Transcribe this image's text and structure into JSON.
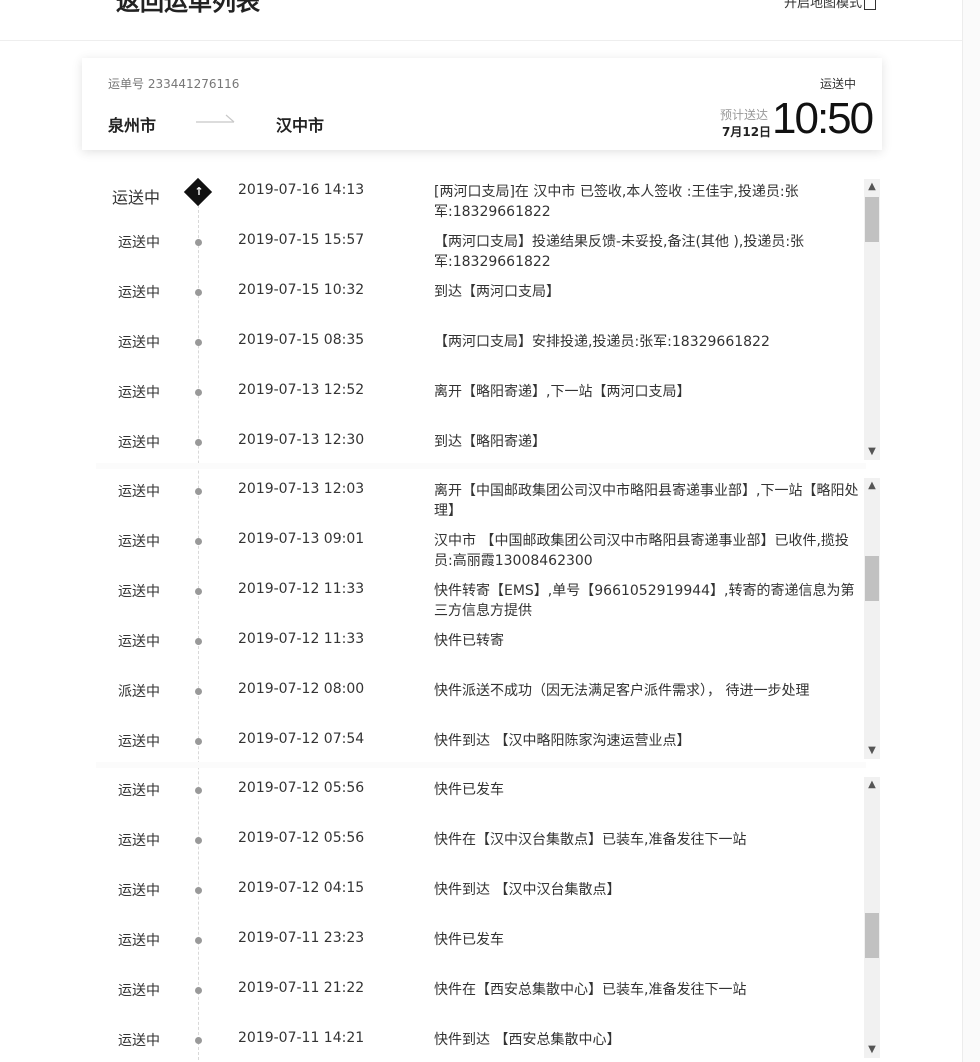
{
  "header": {
    "back_icon": "chevron-left-icon",
    "title": "返回运单列表",
    "map_mode": "开启地图模式"
  },
  "card": {
    "waybill": "运单号 233441276116",
    "origin": "泉州市",
    "destination": "汉中市",
    "status": "运送中",
    "eta_label": "预计送达",
    "eta_date": "7月12日",
    "eta_time": "10:50"
  },
  "events": [
    {
      "status": "运送中",
      "time": "2019-07-16 14:13",
      "desc": "[两河口支局]在 汉中市 已签收,本人签收 :王佳宇,投递员:张军:18329661822"
    },
    {
      "status": "运送中",
      "time": "2019-07-15 15:57",
      "desc": "【两河口支局】投递结果反馈-未妥投,备注(其他 ),投递员:张军:18329661822"
    },
    {
      "status": "运送中",
      "time": "2019-07-15 10:32",
      "desc": "到达【两河口支局】"
    },
    {
      "status": "运送中",
      "time": "2019-07-15 08:35",
      "desc": "【两河口支局】安排投递,投递员:张军:18329661822"
    },
    {
      "status": "运送中",
      "time": "2019-07-13 12:52",
      "desc": "离开【略阳寄递】,下一站【两河口支局】"
    },
    {
      "status": "运送中",
      "time": "2019-07-13 12:30",
      "desc": "到达【略阳寄递】"
    },
    {
      "status": "运送中",
      "time": "2019-07-13 12:03",
      "desc": "离开【中国邮政集团公司汉中市略阳县寄递事业部】,下一站【略阳处理】"
    },
    {
      "status": "运送中",
      "time": "2019-07-13 09:01",
      "desc": "汉中市 【中国邮政集团公司汉中市略阳县寄递事业部】已收件,揽投员:高丽霞13008462300"
    },
    {
      "status": "运送中",
      "time": "2019-07-12 11:33",
      "desc": "快件转寄【EMS】,单号【9661052919944】,转寄的寄递信息为第三方信息方提供"
    },
    {
      "status": "运送中",
      "time": "2019-07-12 11:33",
      "desc": "快件已转寄"
    },
    {
      "status": "派送中",
      "time": "2019-07-12 08:00",
      "desc": "快件派送不成功（因无法满足客户派件需求）， 待进一步处理"
    },
    {
      "status": "运送中",
      "time": "2019-07-12 07:54",
      "desc": "快件到达 【汉中略阳陈家沟速运营业点】"
    },
    {
      "status": "运送中",
      "time": "2019-07-12 05:56",
      "desc": "快件已发车"
    },
    {
      "status": "运送中",
      "time": "2019-07-12 05:56",
      "desc": "快件在【汉中汉台集散点】已装车,准备发往下一站"
    },
    {
      "status": "运送中",
      "time": "2019-07-12 04:15",
      "desc": "快件到达 【汉中汉台集散点】"
    },
    {
      "status": "运送中",
      "time": "2019-07-11 23:23",
      "desc": "快件已发车"
    },
    {
      "status": "运送中",
      "time": "2019-07-11 21:22",
      "desc": "快件在【西安总集散中心】已装车,准备发往下一站"
    },
    {
      "status": "运送中",
      "time": "2019-07-11 14:21",
      "desc": "快件到达 【西安总集散中心】"
    }
  ],
  "icons": {
    "latest_marker": "up-arrow-diamond-icon",
    "scroll_up": "chevron-up-icon",
    "scroll_down": "chevron-down-icon"
  }
}
